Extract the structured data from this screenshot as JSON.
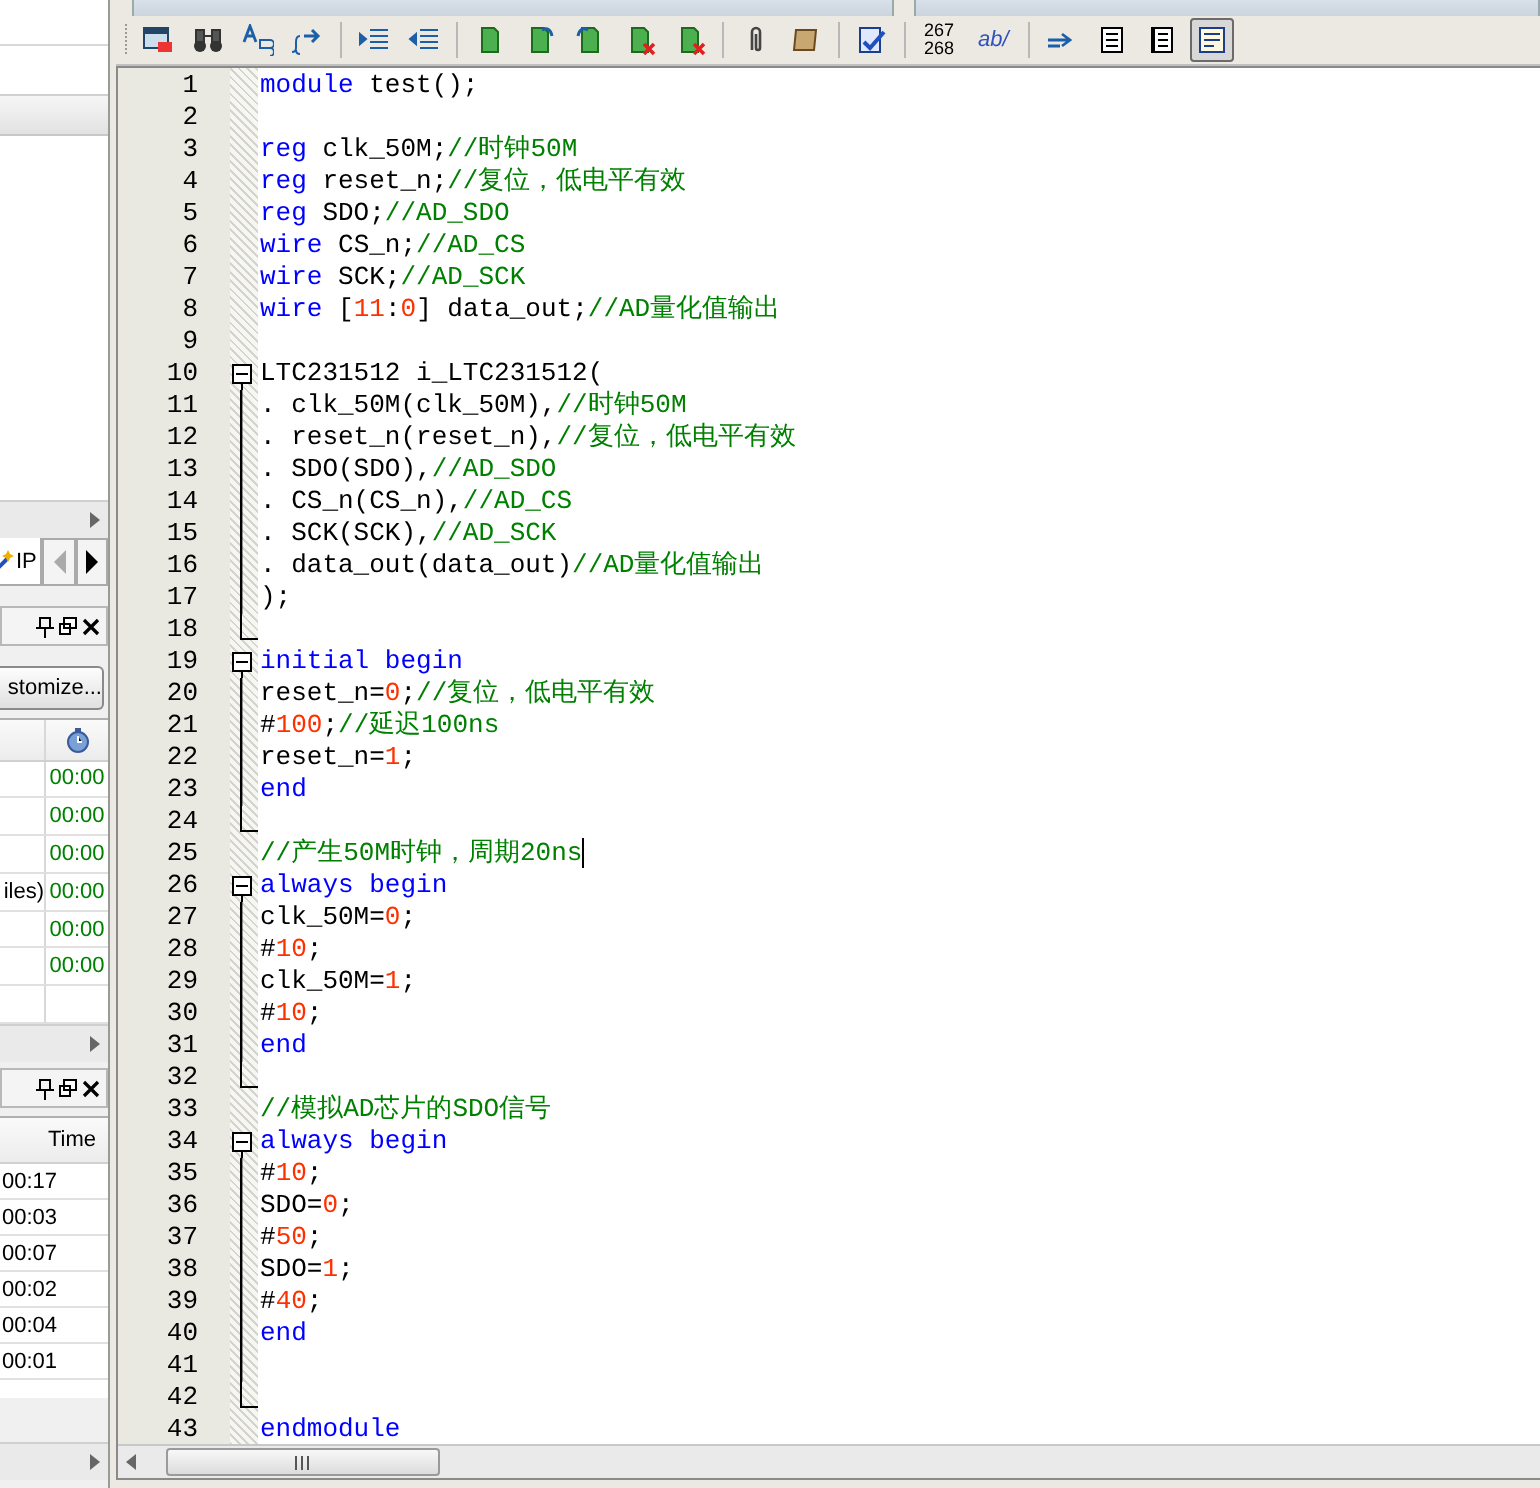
{
  "left_panel": {
    "ip_tab": {
      "label": "IP"
    },
    "messages": {
      "customize_button": "stomize...",
      "rows": [
        {
          "time": "00:00"
        },
        {
          "time": "00:00"
        },
        {
          "time": "00:00"
        },
        {
          "name": "iles)",
          "time": "00:00"
        },
        {
          "time": "00:00"
        },
        {
          "time": "00:00"
        }
      ]
    },
    "flow": {
      "time_header": "Time",
      "times": [
        "00:17",
        "00:03",
        "00:07",
        "00:02",
        "00:04",
        "00:01"
      ]
    }
  },
  "toolbar": {
    "line_numbers": [
      "267",
      "268"
    ],
    "replace_label": "ab/",
    "view_buttons": [
      {
        "selected": false
      },
      {
        "selected": false
      },
      {
        "selected": true
      }
    ]
  },
  "editor": {
    "lines": [
      {
        "number": "1",
        "kind": "plain",
        "tokens": [
          {
            "kind": "kw",
            "text": "module"
          },
          {
            "kind": "pl",
            "text": " test();"
          }
        ]
      },
      {
        "number": "2",
        "kind": "plain"
      },
      {
        "number": "3",
        "kind": "plain",
        "tokens": [
          {
            "kind": "kw",
            "text": "reg"
          },
          {
            "kind": "pl",
            "text": " clk_50M;"
          },
          {
            "kind": "cm",
            "text": "//时钟50M"
          }
        ]
      },
      {
        "number": "4",
        "kind": "plain",
        "tokens": [
          {
            "kind": "kw",
            "text": "reg"
          },
          {
            "kind": "pl",
            "text": " reset_n;"
          },
          {
            "kind": "cm",
            "text": "//复位，低电平有效"
          }
        ]
      },
      {
        "number": "5",
        "kind": "plain",
        "tokens": [
          {
            "kind": "kw",
            "text": "reg"
          },
          {
            "kind": "pl",
            "text": " SDO;"
          },
          {
            "kind": "cm",
            "text": "//AD_SDO"
          }
        ]
      },
      {
        "number": "6",
        "kind": "plain",
        "tokens": [
          {
            "kind": "kw",
            "text": "wire"
          },
          {
            "kind": "pl",
            "text": " CS_n;"
          },
          {
            "kind": "cm",
            "text": "//AD_CS"
          }
        ]
      },
      {
        "number": "7",
        "kind": "plain",
        "tokens": [
          {
            "kind": "kw",
            "text": "wire"
          },
          {
            "kind": "pl",
            "text": " SCK;"
          },
          {
            "kind": "cm",
            "text": "//AD_SCK"
          }
        ]
      },
      {
        "number": "8",
        "kind": "plain",
        "tokens": [
          {
            "kind": "kw",
            "text": "wire"
          },
          {
            "kind": "pl",
            "text": " ["
          },
          {
            "kind": "num",
            "text": "11"
          },
          {
            "kind": "pl",
            "text": ":"
          },
          {
            "kind": "num",
            "text": "0"
          },
          {
            "kind": "pl",
            "text": "] data_out;"
          },
          {
            "kind": "cm",
            "text": "//AD量化值输出"
          }
        ]
      },
      {
        "number": "9",
        "kind": "plain"
      },
      {
        "number": "10",
        "kind": "fold_start",
        "tokens": [
          {
            "kind": "pl",
            "text": "LTC231512 i_LTC231512("
          }
        ]
      },
      {
        "number": "11",
        "kind": "fold_inner",
        "tokens": [
          {
            "kind": "pl",
            "text": ". clk_50M(clk_50M),"
          },
          {
            "kind": "cm",
            "text": "//时钟50M"
          }
        ]
      },
      {
        "number": "12",
        "kind": "fold_inner",
        "tokens": [
          {
            "kind": "pl",
            "text": ". reset_n(reset_n),"
          },
          {
            "kind": "cm",
            "text": "//复位，低电平有效"
          }
        ]
      },
      {
        "number": "13",
        "kind": "fold_inner",
        "tokens": [
          {
            "kind": "pl",
            "text": ". SDO(SDO),"
          },
          {
            "kind": "cm",
            "text": "//AD_SDO"
          }
        ]
      },
      {
        "number": "14",
        "kind": "fold_inner",
        "tokens": [
          {
            "kind": "pl",
            "text": ". CS_n(CS_n),"
          },
          {
            "kind": "cm",
            "text": "//AD_CS"
          }
        ]
      },
      {
        "number": "15",
        "kind": "fold_inner",
        "tokens": [
          {
            "kind": "pl",
            "text": ". SCK(SCK),"
          },
          {
            "kind": "cm",
            "text": "//AD_SCK"
          }
        ]
      },
      {
        "number": "16",
        "kind": "fold_inner",
        "tokens": [
          {
            "kind": "pl",
            "text": ". data_out(data_out)"
          },
          {
            "kind": "cm",
            "text": "//AD量化值输出"
          }
        ]
      },
      {
        "number": "17",
        "kind": "fold_inner",
        "tokens": [
          {
            "kind": "pl",
            "text": ");"
          }
        ]
      },
      {
        "number": "18",
        "kind": "fold_end"
      },
      {
        "number": "19",
        "kind": "fold_start",
        "tokens": [
          {
            "kind": "kw",
            "text": "initial begin"
          }
        ]
      },
      {
        "number": "20",
        "kind": "fold_inner",
        "tokens": [
          {
            "kind": "pl",
            "text": "reset_n="
          },
          {
            "kind": "num",
            "text": "0"
          },
          {
            "kind": "pl",
            "text": ";"
          },
          {
            "kind": "cm",
            "text": "//复位，低电平有效"
          }
        ]
      },
      {
        "number": "21",
        "kind": "fold_inner",
        "tokens": [
          {
            "kind": "pl",
            "text": "#"
          },
          {
            "kind": "num",
            "text": "100"
          },
          {
            "kind": "pl",
            "text": ";"
          },
          {
            "kind": "cm",
            "text": "//延迟100ns"
          }
        ]
      },
      {
        "number": "22",
        "kind": "fold_inner",
        "tokens": [
          {
            "kind": "pl",
            "text": "reset_n="
          },
          {
            "kind": "num",
            "text": "1"
          },
          {
            "kind": "pl",
            "text": ";"
          }
        ]
      },
      {
        "number": "23",
        "kind": "fold_inner",
        "tokens": [
          {
            "kind": "kw",
            "text": "end"
          }
        ]
      },
      {
        "number": "24",
        "kind": "fold_end"
      },
      {
        "number": "25",
        "kind": "plain",
        "cursor": true,
        "tokens": [
          {
            "kind": "cm",
            "text": "//产生50M时钟，周期20ns"
          }
        ]
      },
      {
        "number": "26",
        "kind": "fold_start",
        "tokens": [
          {
            "kind": "kw",
            "text": "always begin"
          }
        ]
      },
      {
        "number": "27",
        "kind": "fold_inner",
        "tokens": [
          {
            "kind": "pl",
            "text": "clk_50M="
          },
          {
            "kind": "num",
            "text": "0"
          },
          {
            "kind": "pl",
            "text": ";"
          }
        ]
      },
      {
        "number": "28",
        "kind": "fold_inner",
        "tokens": [
          {
            "kind": "pl",
            "text": "#"
          },
          {
            "kind": "num",
            "text": "10"
          },
          {
            "kind": "pl",
            "text": ";"
          }
        ]
      },
      {
        "number": "29",
        "kind": "fold_inner",
        "tokens": [
          {
            "kind": "pl",
            "text": "clk_50M="
          },
          {
            "kind": "num",
            "text": "1"
          },
          {
            "kind": "pl",
            "text": ";"
          }
        ]
      },
      {
        "number": "30",
        "kind": "fold_inner",
        "tokens": [
          {
            "kind": "pl",
            "text": "#"
          },
          {
            "kind": "num",
            "text": "10"
          },
          {
            "kind": "pl",
            "text": ";"
          }
        ]
      },
      {
        "number": "31",
        "kind": "fold_inner",
        "tokens": [
          {
            "kind": "kw",
            "text": "end"
          }
        ]
      },
      {
        "number": "32",
        "kind": "fold_end"
      },
      {
        "number": "33",
        "kind": "plain",
        "tokens": [
          {
            "kind": "cm",
            "text": "//模拟AD芯片的SDO信号"
          }
        ]
      },
      {
        "number": "34",
        "kind": "fold_start",
        "tokens": [
          {
            "kind": "kw",
            "text": "always begin"
          }
        ]
      },
      {
        "number": "35",
        "kind": "fold_inner",
        "tokens": [
          {
            "kind": "pl",
            "text": "#"
          },
          {
            "kind": "num",
            "text": "10"
          },
          {
            "kind": "pl",
            "text": ";"
          }
        ]
      },
      {
        "number": "36",
        "kind": "fold_inner",
        "tokens": [
          {
            "kind": "pl",
            "text": "SDO="
          },
          {
            "kind": "num",
            "text": "0"
          },
          {
            "kind": "pl",
            "text": ";"
          }
        ]
      },
      {
        "number": "37",
        "kind": "fold_inner",
        "tokens": [
          {
            "kind": "pl",
            "text": "#"
          },
          {
            "kind": "num",
            "text": "50"
          },
          {
            "kind": "pl",
            "text": ";"
          }
        ]
      },
      {
        "number": "38",
        "kind": "fold_inner",
        "tokens": [
          {
            "kind": "pl",
            "text": "SDO="
          },
          {
            "kind": "num",
            "text": "1"
          },
          {
            "kind": "pl",
            "text": ";"
          }
        ]
      },
      {
        "number": "39",
        "kind": "fold_inner",
        "tokens": [
          {
            "kind": "pl",
            "text": "#"
          },
          {
            "kind": "num",
            "text": "40"
          },
          {
            "kind": "pl",
            "text": ";"
          }
        ]
      },
      {
        "number": "40",
        "kind": "fold_inner",
        "tokens": [
          {
            "kind": "kw",
            "text": "end"
          }
        ]
      },
      {
        "number": "41",
        "kind": "fold_inner"
      },
      {
        "number": "42",
        "kind": "fold_end"
      },
      {
        "number": "43",
        "kind": "plain",
        "tokens": [
          {
            "kind": "kw",
            "text": "endmodule"
          }
        ]
      }
    ]
  }
}
